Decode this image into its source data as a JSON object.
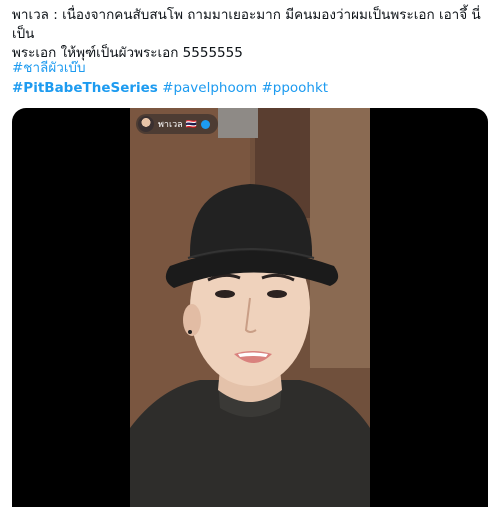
{
  "tweet": {
    "line1": "พาเวล : เนื่องจากคนสับสนโพ ถามมาเยอะมาก มีคนมองว่าผมเป็นพระเอก เอาจึ้ นี่เป็น",
    "line2": "พระเอก ให้พุฑ์เป็นผัวพระเอก 5555555"
  },
  "hashtags": [
    "#ชาลีผัวเบ๊บ",
    "#PitBabeTheSeries",
    "#pavelphoom",
    "#ppoohkt"
  ],
  "video": {
    "live_user": "พาเวล 🇹🇭"
  },
  "colors": {
    "link": "#1d9bf0",
    "text": "#0f1419"
  }
}
